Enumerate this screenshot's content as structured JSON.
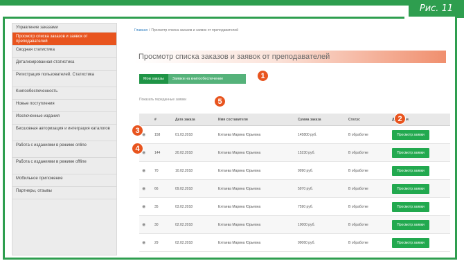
{
  "figure_label": "Рис. 11",
  "colors": {
    "brand": "#2e9e4f",
    "accent": "#e8541e",
    "button": "#22a94f"
  },
  "sidebar": {
    "items": [
      {
        "label": "Управление заказами",
        "active": false
      },
      {
        "label": "Просмотр списка заказов и заявок от преподавателей",
        "active": true
      },
      {
        "label": "Сводная статистика",
        "active": false
      },
      {
        "label": "Детализированная статистика",
        "active": false
      },
      {
        "label": "Регистрация пользователей. Статистика",
        "active": false
      },
      {
        "label": "Книгообеспеченность",
        "active": false
      },
      {
        "label": "Новые поступления",
        "active": false
      },
      {
        "label": "Исключенные издания",
        "active": false
      },
      {
        "label": "Бесшовная авторизация и интеграция каталогов",
        "active": false
      },
      {
        "label": "Работа с изданиями в режиме online",
        "active": false
      },
      {
        "label": "Работа с изданиями в режиме offline",
        "active": false
      },
      {
        "label": "Мобильное приложение",
        "active": false
      },
      {
        "label": "Партнеры, отзывы",
        "active": false
      }
    ]
  },
  "breadcrumb": {
    "home": "Главная",
    "separator": "/",
    "current": "Просмотр списка заказов и заявок от преподавателей"
  },
  "page_title": "Просмотр списка заказов и заявок от преподавателей",
  "tabs": [
    {
      "label": "Мои заказы"
    },
    {
      "label": "Заявки на книгообеспечение"
    }
  ],
  "filter_link": "Показать переданные заявки",
  "table": {
    "headers": [
      "#",
      "Дата заказа",
      "Имя составителя",
      "Сумма заказа",
      "Статус",
      "Действия"
    ],
    "rows": [
      {
        "id": "158",
        "date": "01.03.2018",
        "name": "Ехтаева Марина Юрьевна",
        "sum": "145800 руб.",
        "status": "В обработке",
        "action": "Просмотр заявки"
      },
      {
        "id": "144",
        "date": "20.02.2018",
        "name": "Ехтаева Марина Юрьевна",
        "sum": "15230 руб.",
        "status": "В обработке",
        "action": "Просмотр заявки"
      },
      {
        "id": "70",
        "date": "10.02.2018",
        "name": "Ехтаева Марина Юрьевна",
        "sum": "9990 руб.",
        "status": "В обработке",
        "action": "Просмотр заявки"
      },
      {
        "id": "66",
        "date": "09.02.2018",
        "name": "Ехтаева Марина Юрьевна",
        "sum": "5970 руб.",
        "status": "В обработке",
        "action": "Просмотр заявки"
      },
      {
        "id": "35",
        "date": "03.02.2018",
        "name": "Ехтаева Марина Юрьевна",
        "sum": "7590 руб.",
        "status": "В обработке",
        "action": "Просмотр заявки"
      },
      {
        "id": "30",
        "date": "02.02.2018",
        "name": "Ехтаева Марина Юрьевна",
        "sum": "10000 руб.",
        "status": "В обработке",
        "action": "Просмотр заявки"
      },
      {
        "id": "29",
        "date": "02.02.2018",
        "name": "Ехтаева Марина Юрьевна",
        "sum": "99060 руб.",
        "status": "В обработке",
        "action": "Просмотр заявки"
      }
    ]
  },
  "markers": [
    {
      "label": "1",
      "target": "tab-requests"
    },
    {
      "label": "2",
      "target": "view-request-button"
    },
    {
      "label": "3",
      "target": "row-158"
    },
    {
      "label": "4",
      "target": "row-144"
    },
    {
      "label": "5",
      "target": "filter-link"
    }
  ]
}
